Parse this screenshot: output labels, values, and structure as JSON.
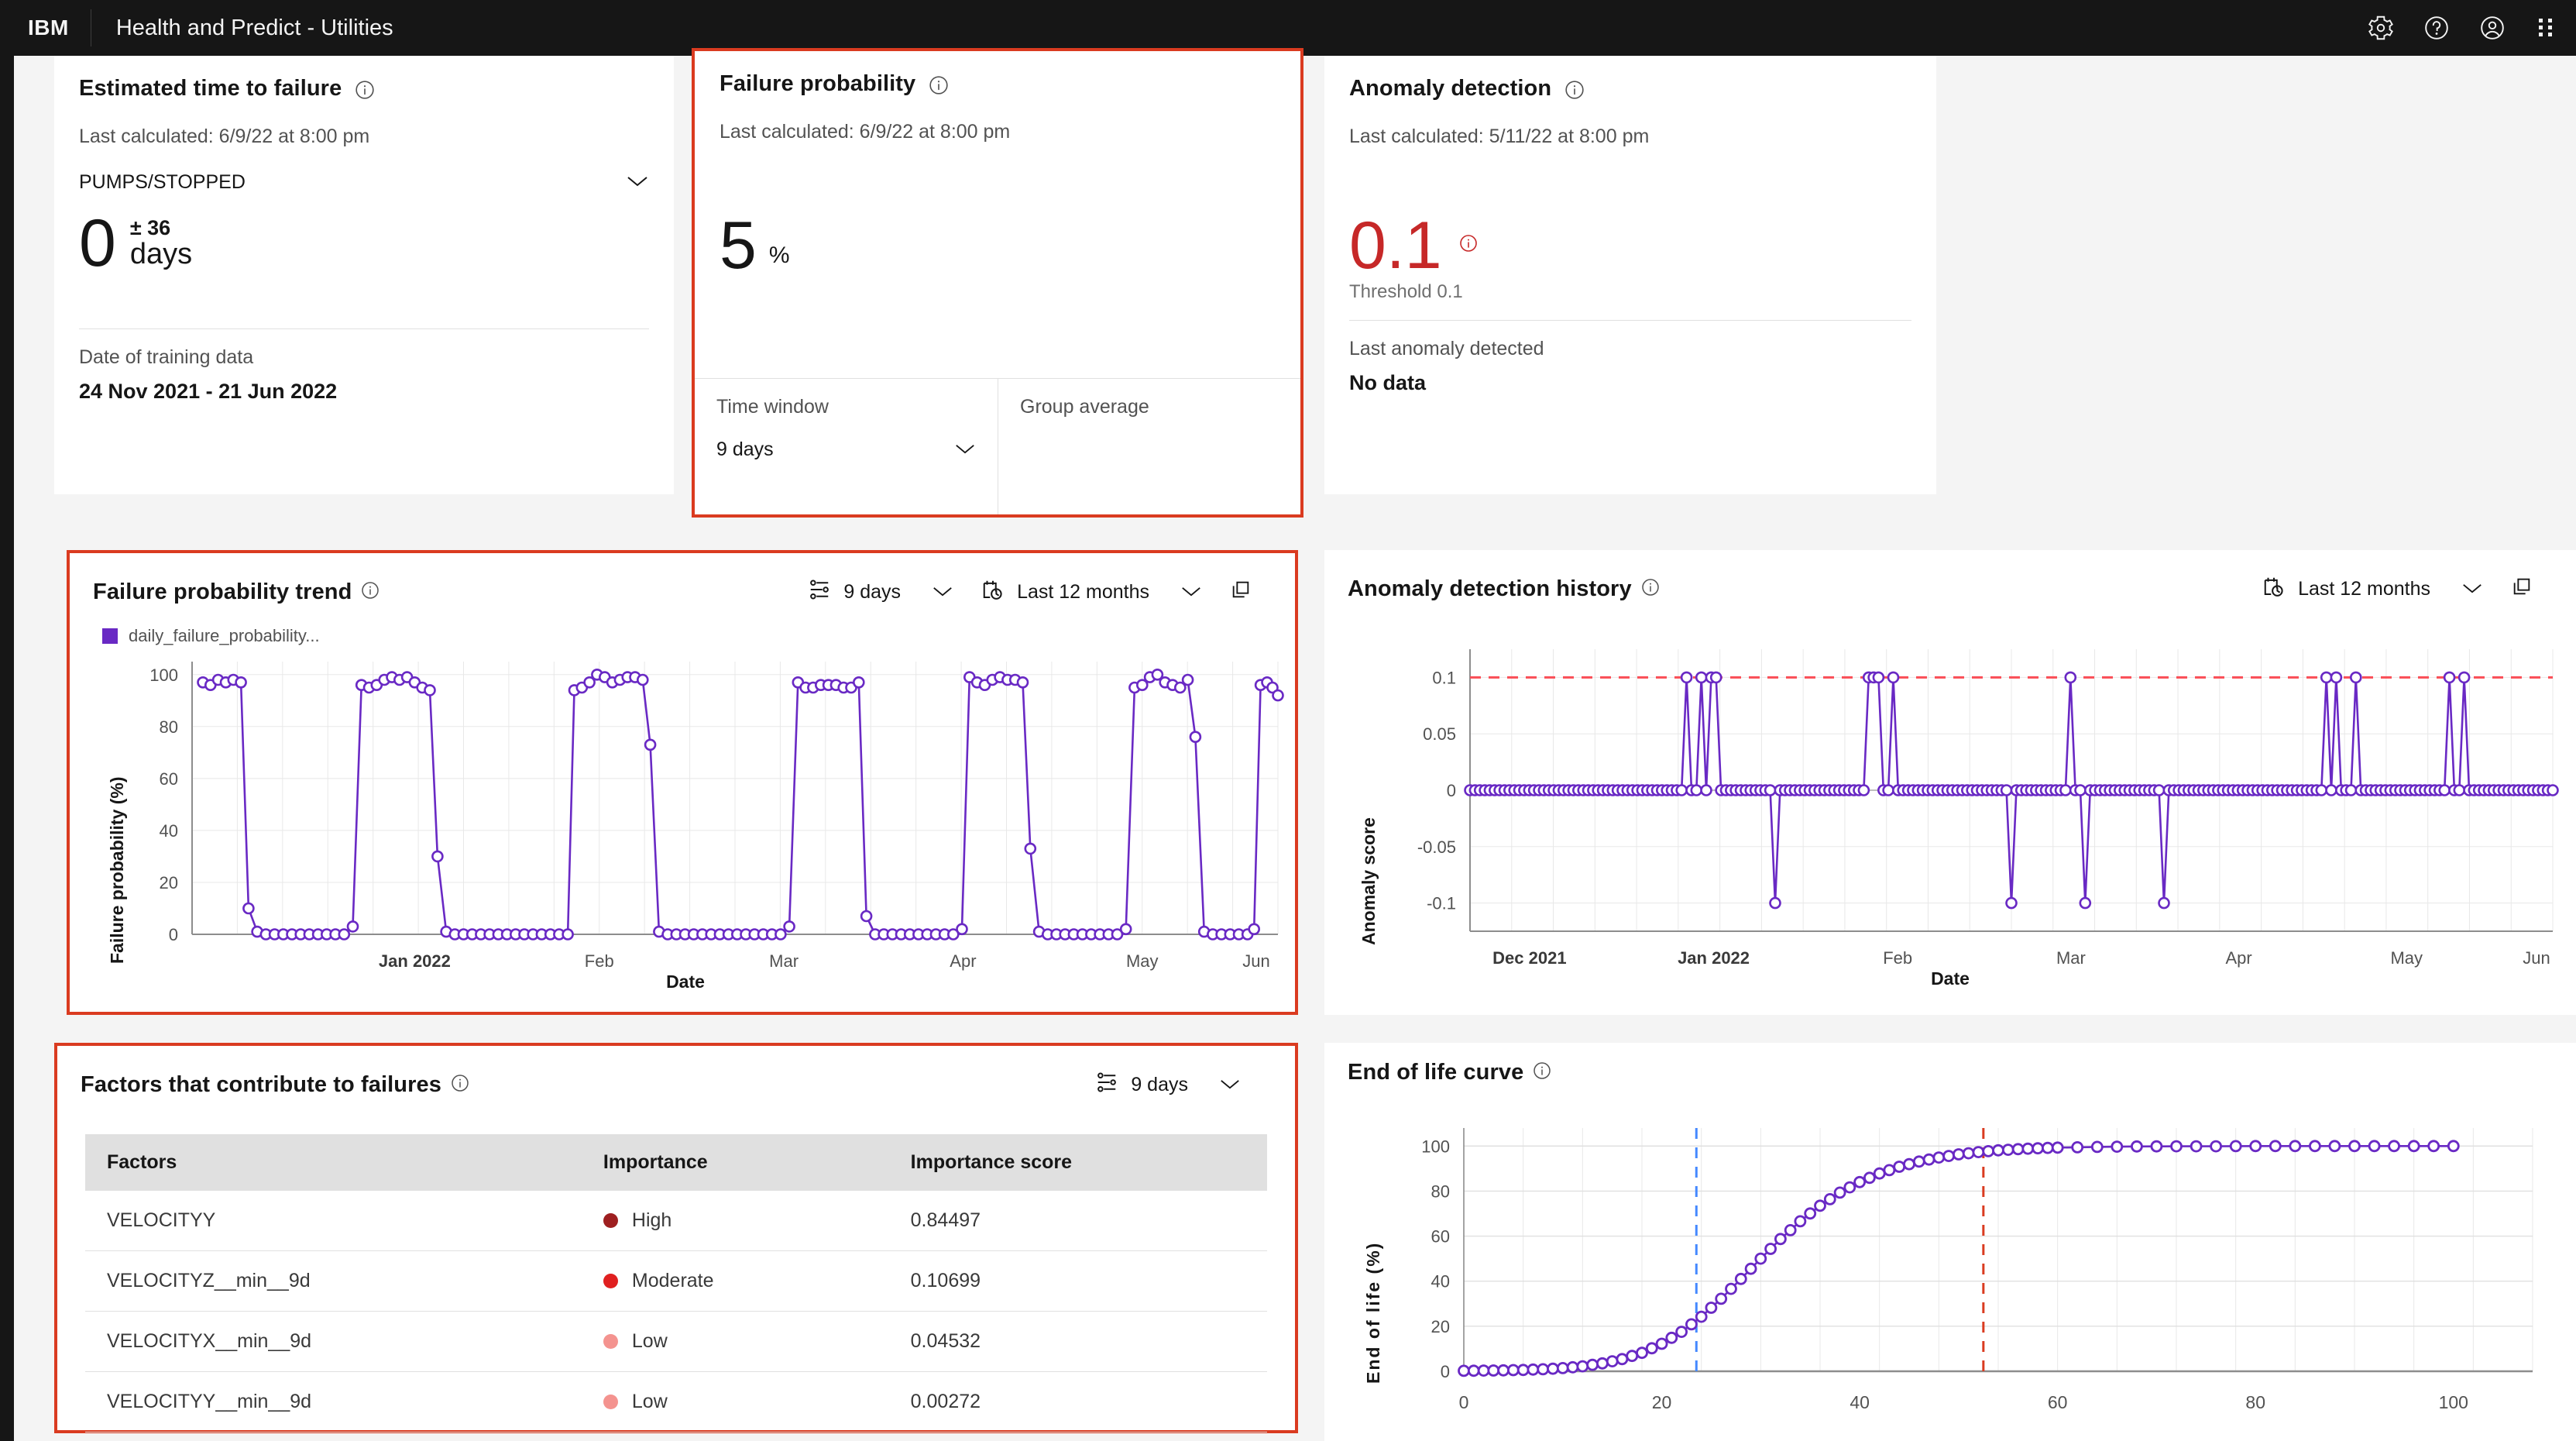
{
  "header": {
    "brand": "IBM",
    "title": "Health and Predict - Utilities",
    "icons": [
      {
        "name": "gear-icon",
        "label": "Settings"
      },
      {
        "name": "help-icon",
        "label": "Help"
      },
      {
        "name": "user-avatar-icon",
        "label": "Account"
      },
      {
        "name": "app-switcher-icon",
        "label": "Switcher"
      }
    ]
  },
  "colors": {
    "accent_red": "#da3b20",
    "series_purple": "#6929c4",
    "danger_red": "#c62828",
    "threshold_red": "#fa4d56",
    "reference_blue": "#4589ff",
    "header_black": "#161616"
  },
  "cards": {
    "etf": {
      "title": "Estimated time to failure",
      "last_calculated": "Last calculated: 6/9/22 at 8:00 pm",
      "asset_select": "PUMPS/STOPPED",
      "value": "0",
      "plus_minus": "± 36",
      "unit": "days",
      "footer_label": "Date of training data",
      "footer_value": "24 Nov 2021 - 21 Jun 2022",
      "selected": false
    },
    "fp": {
      "title": "Failure probability",
      "last_calculated": "Last calculated: 6/9/22 at 8:00 pm",
      "value": "5",
      "unit": "%",
      "time_window_label": "Time window",
      "time_window_value": "9 days",
      "group_average_label": "Group average",
      "group_average_value": "",
      "selected": true
    },
    "ad": {
      "title": "Anomaly detection",
      "last_calculated": "Last calculated: 5/11/22 at 8:00 pm",
      "value": "0.1",
      "threshold": "Threshold 0.1",
      "footer_label": "Last anomaly detected",
      "footer_value": "No data",
      "selected": false
    },
    "fpt": {
      "title": "Failure probability trend",
      "window_value": "9 days",
      "range_value": "Last 12 months",
      "selected": true
    },
    "adh": {
      "title": "Anomaly detection history",
      "range_value": "Last 12 months",
      "selected": false
    },
    "factors": {
      "title": "Factors that contribute to failures",
      "window_value": "9 days",
      "selected": true,
      "columns": [
        "Factors",
        "Importance",
        "Importance score"
      ],
      "rows": [
        {
          "factor": "VELOCITYY",
          "importance": "High",
          "color": "#9e1f20",
          "score": "0.84497"
        },
        {
          "factor": "VELOCITYZ__min__9d",
          "importance": "Moderate",
          "color": "#e02020",
          "score": "0.10699"
        },
        {
          "factor": "VELOCITYX__min__9d",
          "importance": "Low",
          "color": "#f4938f",
          "score": "0.04532"
        },
        {
          "factor": "VELOCITYY__min__9d",
          "importance": "Low",
          "color": "#f4938f",
          "score": "0.00272"
        }
      ]
    },
    "eol": {
      "title": "End of life curve",
      "selected": false
    }
  },
  "chart_data": [
    {
      "id": "failure_probability_trend",
      "type": "line",
      "title": "Failure probability trend",
      "xlabel": "Date",
      "ylabel": "Failure probability (%)",
      "legend": [
        "daily_failure_probability..."
      ],
      "legend_position": "top-left",
      "grid": true,
      "ylim": [
        0,
        105
      ],
      "yticks": [
        0,
        20,
        40,
        60,
        80,
        100
      ],
      "xticks": [
        "Jan 2022",
        "Feb",
        "Mar",
        "Apr",
        "May",
        "Jun"
      ],
      "xtick_positions": [
        0.205,
        0.375,
        0.545,
        0.71,
        0.875,
        0.98
      ],
      "series": [
        {
          "name": "daily_failure_probability...",
          "color": "#6929c4",
          "note": "Repeating square-wave pattern: ~7 day plateaus near 97-100% alternating with long runs at ~0%, one intermediate transition point per cycle.",
          "points": [
            [
              0.01,
              97
            ],
            [
              0.017,
              96
            ],
            [
              0.024,
              98
            ],
            [
              0.031,
              97
            ],
            [
              0.038,
              98
            ],
            [
              0.045,
              97
            ],
            [
              0.052,
              10
            ],
            [
              0.06,
              1
            ],
            [
              0.068,
              0
            ],
            [
              0.076,
              0
            ],
            [
              0.084,
              0
            ],
            [
              0.092,
              0
            ],
            [
              0.1,
              0
            ],
            [
              0.108,
              0
            ],
            [
              0.116,
              0
            ],
            [
              0.124,
              0
            ],
            [
              0.132,
              0
            ],
            [
              0.14,
              0
            ],
            [
              0.148,
              3
            ],
            [
              0.156,
              96
            ],
            [
              0.163,
              95
            ],
            [
              0.17,
              96
            ],
            [
              0.177,
              98
            ],
            [
              0.184,
              99
            ],
            [
              0.191,
              98
            ],
            [
              0.198,
              99
            ],
            [
              0.205,
              97
            ],
            [
              0.212,
              95
            ],
            [
              0.219,
              94
            ],
            [
              0.226,
              30
            ],
            [
              0.234,
              1
            ],
            [
              0.242,
              0
            ],
            [
              0.25,
              0
            ],
            [
              0.258,
              0
            ],
            [
              0.266,
              0
            ],
            [
              0.274,
              0
            ],
            [
              0.282,
              0
            ],
            [
              0.29,
              0
            ],
            [
              0.298,
              0
            ],
            [
              0.306,
              0
            ],
            [
              0.314,
              0
            ],
            [
              0.322,
              0
            ],
            [
              0.33,
              0
            ],
            [
              0.338,
              0
            ],
            [
              0.346,
              0
            ],
            [
              0.352,
              94
            ],
            [
              0.359,
              95
            ],
            [
              0.366,
              97
            ],
            [
              0.373,
              100
            ],
            [
              0.38,
              99
            ],
            [
              0.387,
              97
            ],
            [
              0.394,
              98
            ],
            [
              0.401,
              99
            ],
            [
              0.408,
              99
            ],
            [
              0.415,
              98
            ],
            [
              0.422,
              73
            ],
            [
              0.43,
              1
            ],
            [
              0.438,
              0
            ],
            [
              0.446,
              0
            ],
            [
              0.454,
              0
            ],
            [
              0.462,
              0
            ],
            [
              0.47,
              0
            ],
            [
              0.478,
              0
            ],
            [
              0.486,
              0
            ],
            [
              0.494,
              0
            ],
            [
              0.502,
              0
            ],
            [
              0.51,
              0
            ],
            [
              0.518,
              0
            ],
            [
              0.526,
              0
            ],
            [
              0.534,
              0
            ],
            [
              0.542,
              0
            ],
            [
              0.55,
              3
            ],
            [
              0.558,
              97
            ],
            [
              0.565,
              95
            ],
            [
              0.572,
              95
            ],
            [
              0.579,
              96
            ],
            [
              0.586,
              96
            ],
            [
              0.593,
              96
            ],
            [
              0.6,
              95
            ],
            [
              0.607,
              95
            ],
            [
              0.614,
              97
            ],
            [
              0.621,
              7
            ],
            [
              0.629,
              0
            ],
            [
              0.637,
              0
            ],
            [
              0.645,
              0
            ],
            [
              0.653,
              0
            ],
            [
              0.661,
              0
            ],
            [
              0.669,
              0
            ],
            [
              0.677,
              0
            ],
            [
              0.685,
              0
            ],
            [
              0.693,
              0
            ],
            [
              0.701,
              0
            ],
            [
              0.709,
              2
            ],
            [
              0.716,
              99
            ],
            [
              0.723,
              97
            ],
            [
              0.73,
              96
            ],
            [
              0.737,
              98
            ],
            [
              0.744,
              99
            ],
            [
              0.751,
              98
            ],
            [
              0.758,
              98
            ],
            [
              0.765,
              97
            ],
            [
              0.772,
              33
            ],
            [
              0.78,
              1
            ],
            [
              0.788,
              0
            ],
            [
              0.796,
              0
            ],
            [
              0.804,
              0
            ],
            [
              0.812,
              0
            ],
            [
              0.82,
              0
            ],
            [
              0.828,
              0
            ],
            [
              0.836,
              0
            ],
            [
              0.844,
              0
            ],
            [
              0.852,
              0
            ],
            [
              0.86,
              2
            ],
            [
              0.868,
              95
            ],
            [
              0.875,
              96
            ],
            [
              0.882,
              99
            ],
            [
              0.889,
              100
            ],
            [
              0.896,
              97
            ],
            [
              0.903,
              96
            ],
            [
              0.91,
              95
            ],
            [
              0.917,
              98
            ],
            [
              0.924,
              76
            ],
            [
              0.932,
              1
            ],
            [
              0.94,
              0
            ],
            [
              0.948,
              0
            ],
            [
              0.956,
              0
            ],
            [
              0.964,
              0
            ],
            [
              0.972,
              0
            ],
            [
              0.978,
              2
            ],
            [
              0.984,
              96
            ],
            [
              0.99,
              97
            ],
            [
              0.995,
              95
            ],
            [
              1.0,
              92
            ]
          ]
        }
      ]
    },
    {
      "id": "anomaly_detection_history",
      "type": "line",
      "title": "Anomaly detection history",
      "xlabel": "Date",
      "ylabel": "Anomaly score",
      "grid": true,
      "ylim": [
        -0.125,
        0.125
      ],
      "yticks": [
        -0.1,
        -0.05,
        0,
        0.05,
        0.1
      ],
      "ytick_labels": [
        "-0.1",
        "-0.05",
        "0",
        "0.05",
        "0.1"
      ],
      "xticks": [
        "Dec 2021",
        "Jan 2022",
        "Feb",
        "Mar",
        "Apr",
        "May",
        "Jun"
      ],
      "xtick_positions": [
        0.055,
        0.225,
        0.395,
        0.555,
        0.71,
        0.865,
        0.985
      ],
      "threshold": {
        "value": 0.1,
        "color": "#fa4d56",
        "style": "dashed"
      },
      "series": [
        {
          "name": "anomaly_score",
          "color": "#6929c4",
          "note": "Flat at 0 with occasional spikes to +0.1 (anomalies at threshold) and dips to -0.1.",
          "baseline": 0,
          "spikes_up": [
            0.2,
            0.213,
            0.225,
            0.368,
            0.375,
            0.39,
            0.555,
            0.793,
            0.8,
            0.818,
            0.905,
            0.917
          ],
          "spikes_down": [
            0.283,
            0.5,
            0.568,
            0.64
          ]
        }
      ]
    },
    {
      "id": "end_of_life_curve",
      "type": "line",
      "title": "End of life curve",
      "xlabel": "",
      "ylabel": "End of life (%)",
      "grid": true,
      "xlim": [
        0,
        108
      ],
      "ylim": [
        0,
        108
      ],
      "xticks": [
        0,
        20,
        40,
        60,
        80,
        100
      ],
      "yticks": [
        0,
        20,
        40,
        60,
        80,
        100
      ],
      "reference_lines": [
        {
          "x": 23.5,
          "color": "#4589ff",
          "style": "dashed"
        },
        {
          "x": 52.5,
          "color": "#da3b20",
          "style": "dashed"
        }
      ],
      "series": [
        {
          "name": "end_of_life",
          "color": "#6929c4",
          "note": "Sigmoid / logistic curve from 0% near x=0 saturating at 100% after x~55",
          "points": [
            [
              0,
              0.2
            ],
            [
              2,
              0.3
            ],
            [
              4,
              0.4
            ],
            [
              6,
              0.6
            ],
            [
              8,
              0.9
            ],
            [
              10,
              1.4
            ],
            [
              12,
              2.2
            ],
            [
              14,
              3.5
            ],
            [
              16,
              5.4
            ],
            [
              18,
              8.2
            ],
            [
              20,
              12.2
            ],
            [
              22,
              17.5
            ],
            [
              24,
              24.2
            ],
            [
              26,
              32.2
            ],
            [
              28,
              41.0
            ],
            [
              30,
              50.0
            ],
            [
              32,
              58.7
            ],
            [
              34,
              66.6
            ],
            [
              36,
              73.5
            ],
            [
              38,
              79.3
            ],
            [
              40,
              84.0
            ],
            [
              42,
              87.8
            ],
            [
              44,
              90.8
            ],
            [
              46,
              93.1
            ],
            [
              48,
              94.9
            ],
            [
              50,
              96.3
            ],
            [
              52,
              97.3
            ],
            [
              54,
              98.1
            ],
            [
              56,
              98.6
            ],
            [
              58,
              99.0
            ],
            [
              60,
              99.3
            ],
            [
              64,
              99.6
            ],
            [
              68,
              99.8
            ],
            [
              72,
              99.9
            ],
            [
              76,
              99.9
            ],
            [
              80,
              100
            ],
            [
              84,
              100
            ],
            [
              88,
              100
            ],
            [
              92,
              100
            ],
            [
              96,
              100
            ],
            [
              100,
              100
            ]
          ]
        }
      ]
    }
  ]
}
